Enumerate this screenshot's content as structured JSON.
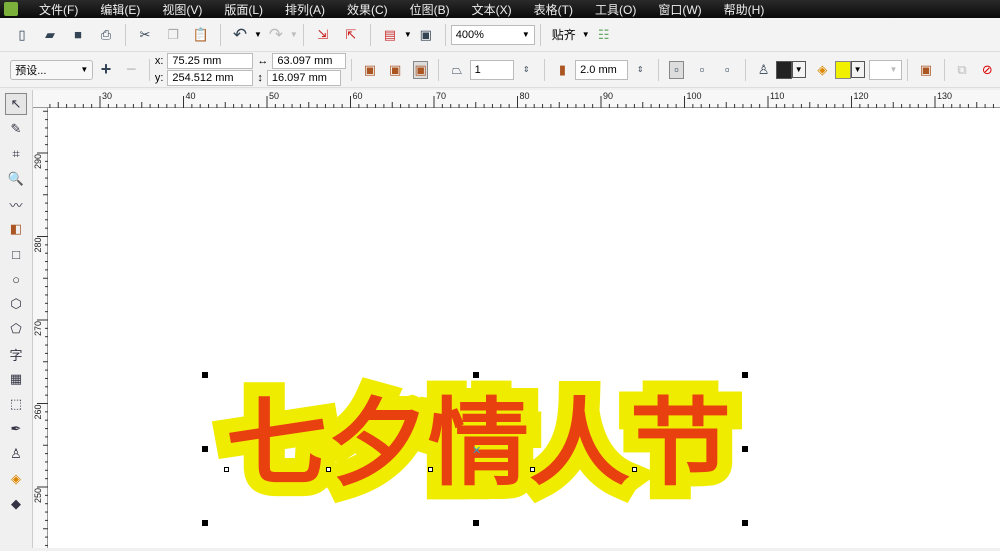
{
  "menu": [
    "文件(F)",
    "编辑(E)",
    "视图(V)",
    "版面(L)",
    "排列(A)",
    "效果(C)",
    "位图(B)",
    "文本(X)",
    "表格(T)",
    "工具(O)",
    "窗口(W)",
    "帮助(H)"
  ],
  "standard_toolbar": {
    "zoom": "400%",
    "snap_label": "贴齐"
  },
  "property_bar": {
    "preset": "预设...",
    "x": "75.25 mm",
    "y": "254.512 mm",
    "x_label": "x:",
    "y_label": "y:",
    "width": "63.097 mm",
    "height": "16.097 mm",
    "steps": "1",
    "offset": "2.0 mm",
    "outline_color": "#222222",
    "fill_color": "#f0f000"
  },
  "rulers": {
    "h": [
      "30",
      "40",
      "50",
      "60",
      "70",
      "80",
      "90",
      "100",
      "110",
      "120",
      "130"
    ],
    "v": [
      "290",
      "280",
      "270",
      "260",
      "250"
    ]
  },
  "canvas": {
    "artwork_text": "七夕情人节",
    "text_color": "#e8400e",
    "contour_color": "#f0ec00"
  }
}
